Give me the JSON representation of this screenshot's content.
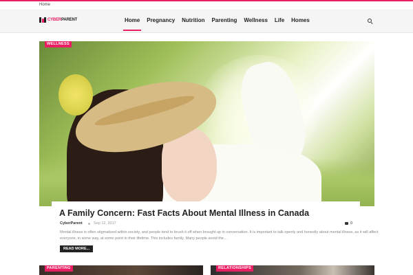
{
  "topbar": {
    "home_link": "Home"
  },
  "logo": {
    "text_a": "CYBER",
    "text_b": "PARENT"
  },
  "nav": {
    "items": [
      {
        "label": "Home",
        "active": true
      },
      {
        "label": "Pregnancy"
      },
      {
        "label": "Nutrition"
      },
      {
        "label": "Parenting"
      },
      {
        "label": "Wellness"
      },
      {
        "label": "Life"
      },
      {
        "label": "Homes"
      }
    ],
    "search_icon": "search-icon"
  },
  "featured": {
    "category": "WELLNESS",
    "title": "A Family Concern: Fast Facts About Mental Illness in Canada",
    "author": "CyberParent",
    "date": "Sep 12, 2017",
    "comments": "0",
    "excerpt": "Mental illness is often stigmatized within society, and people tend to brush it off when brought up in conversation. It is important to talk openly and honestly about mental illness, as it will affect everyone, in some way, at some point in their lifetime. This includes family. Many people avoid the…",
    "read_more": "READ MORE..."
  },
  "cards": [
    {
      "category": "PARENTING"
    },
    {
      "category": "RELATIONSHIPS"
    }
  ],
  "colors": {
    "accent": "#e91e63",
    "dark": "#222222"
  }
}
